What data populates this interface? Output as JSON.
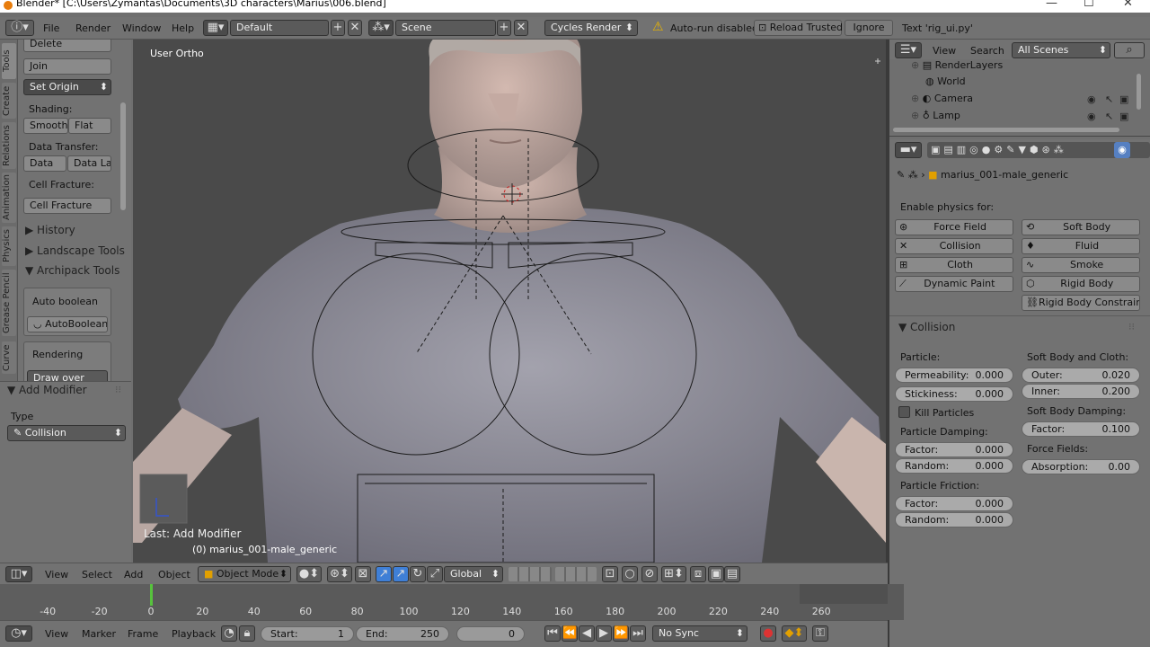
{
  "window": {
    "title": "Blender* [C:\\Users\\Zymantas\\Documents\\3D characters\\Marius\\006.blend]"
  },
  "infobar": {
    "menus": [
      "File",
      "Render",
      "Window",
      "Help"
    ],
    "layout": "Default",
    "scene": "Scene",
    "engine": "Cycles Render",
    "autorun": "Auto-run disabled",
    "reload": "Reload Trusted",
    "ignore": "Ignore",
    "text": "Text 'rig_ui.py'"
  },
  "tabs": [
    "Tools",
    "Create",
    "Relations",
    "Animation",
    "Physics",
    "Grease Pencil",
    "Curve"
  ],
  "toolshelf": {
    "delete": "Delete",
    "join": "Join",
    "set_origin": "Set Origin",
    "shading_label": "Shading:",
    "smooth": "Smooth",
    "flat": "Flat",
    "data_transfer_label": "Data Transfer:",
    "data": "Data",
    "data_la": "Data La",
    "cell_fracture_label": "Cell Fracture:",
    "cell_fracture": "Cell Fracture",
    "history": "History",
    "landscape": "Landscape Tools",
    "archipack": "Archipack Tools",
    "auto_boolean_label": "Auto boolean",
    "auto_boolean": "AutoBoolean",
    "rendering": "Rendering",
    "draw_over": "Draw over"
  },
  "operator": {
    "title": "Add Modifier",
    "type_label": "Type",
    "type_value": "Collision"
  },
  "viewport": {
    "view_name": "User Ortho",
    "last_op": "Last: Add Modifier",
    "object_info": "(0) marius_001-male_generic"
  },
  "outliner": {
    "view": "View",
    "search": "Search",
    "filter": "All Scenes",
    "items": [
      "RenderLayers",
      "World",
      "Camera",
      "Lamp"
    ]
  },
  "properties": {
    "object": "marius_001-male_generic",
    "enable_label": "Enable physics for:",
    "buttons": [
      "Force Field",
      "Soft Body",
      "Collision",
      "Fluid",
      "Cloth",
      "Smoke",
      "Dynamic Paint",
      "Rigid Body",
      "Rigid Body Constraint"
    ],
    "collision_panel": "Collision",
    "particle_label": "Particle:",
    "permeability": {
      "label": "Permeability:",
      "value": "0.000"
    },
    "stickiness": {
      "label": "Stickiness:",
      "value": "0.000"
    },
    "kill_particles": "Kill Particles",
    "particle_damping_label": "Particle Damping:",
    "pd_factor": {
      "label": "Factor:",
      "value": "0.000"
    },
    "pd_random": {
      "label": "Random:",
      "value": "0.000"
    },
    "particle_friction_label": "Particle Friction:",
    "pf_factor": {
      "label": "Factor:",
      "value": "0.000"
    },
    "pf_random": {
      "label": "Random:",
      "value": "0.000"
    },
    "soft_body_cloth_label": "Soft Body and Cloth:",
    "outer": {
      "label": "Outer:",
      "value": "0.020"
    },
    "inner": {
      "label": "Inner:",
      "value": "0.200"
    },
    "sb_damping_label": "Soft Body Damping:",
    "sb_factor": {
      "label": "Factor:",
      "value": "0.100"
    },
    "force_fields_label": "Force Fields:",
    "absorption": {
      "label": "Absorption:",
      "value": "0.00"
    }
  },
  "view_header": {
    "menus": [
      "View",
      "Select",
      "Add",
      "Object"
    ],
    "mode": "Object Mode",
    "orientation": "Global"
  },
  "timeline": {
    "ticks": [
      "-40",
      "-20",
      "0",
      "20",
      "40",
      "60",
      "80",
      "100",
      "120",
      "140",
      "160",
      "180",
      "200",
      "220",
      "240",
      "260"
    ],
    "current_frame": 0,
    "menus": [
      "View",
      "Marker",
      "Frame",
      "Playback"
    ],
    "start": {
      "label": "Start:",
      "value": "1"
    },
    "end": {
      "label": "End:",
      "value": "250"
    },
    "frame": "0",
    "sync": "No Sync"
  },
  "colors": {
    "accent": "#5680c2",
    "frame_marker": "#57c23d",
    "active_blue": "#3f7fd6"
  }
}
